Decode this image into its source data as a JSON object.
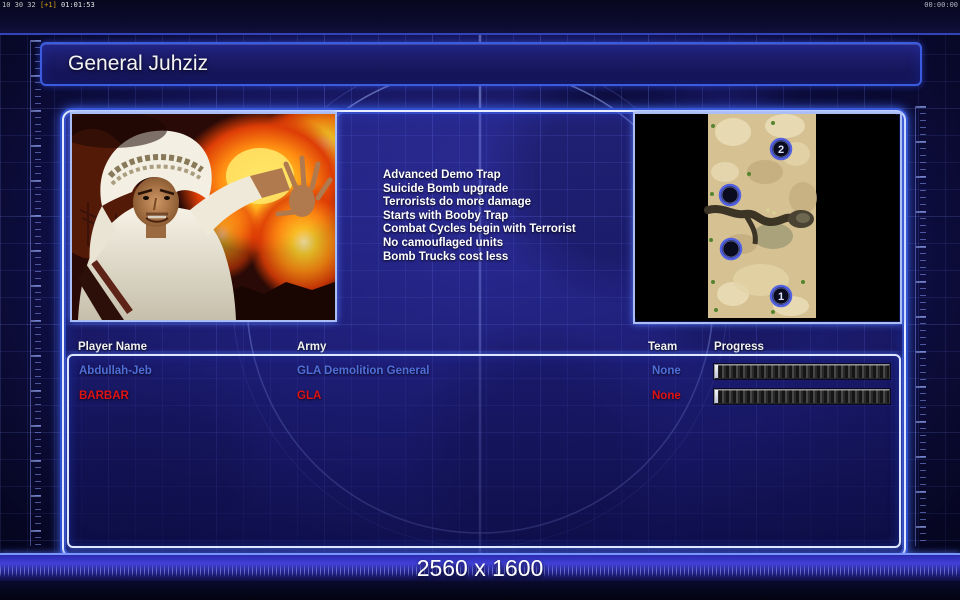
{
  "status_bar": {
    "left_timer_prefix": "10 30 32",
    "left_timer_delta": "[+1]",
    "left_timer_clock": "01:01:53",
    "right_timer": "00:00:00"
  },
  "header": {
    "title": "General Juhziz"
  },
  "general_info": {
    "abilities": [
      "Advanced Demo Trap",
      "Suicide Bomb upgrade",
      "Terrorists do more damage",
      "Starts with Booby Trap",
      "Combat Cycles begin with Terrorist",
      "No camouflaged units",
      "Bomb Trucks cost less"
    ]
  },
  "map_preview": {
    "start_positions": [
      {
        "label": "2"
      },
      {
        "label": ""
      },
      {
        "label": ""
      },
      {
        "label": "1"
      }
    ]
  },
  "players": {
    "columns": [
      "Player Name",
      "Army",
      "Team",
      "Progress"
    ],
    "rows": [
      {
        "name": "Abdullah-Jeb",
        "army": "GLA Demolition General",
        "team": "None",
        "progress_percent": 2,
        "color": "#4f6fd8"
      },
      {
        "name": "BARBAR",
        "army": "GLA",
        "team": "None",
        "progress_percent": 2,
        "color": "#e01212"
      }
    ]
  },
  "footer": {
    "resolution": "2560 x 1600"
  },
  "colors": {
    "background": "#10104a",
    "panel_border": "#e9efff",
    "panel_glow": "#3b5bff",
    "title_text": "#f4f4f4",
    "ability_text": "#ffffff",
    "player1_text": "#4f6fd8",
    "player2_text": "#e01212",
    "map_marker_ring": "#5060e0"
  }
}
